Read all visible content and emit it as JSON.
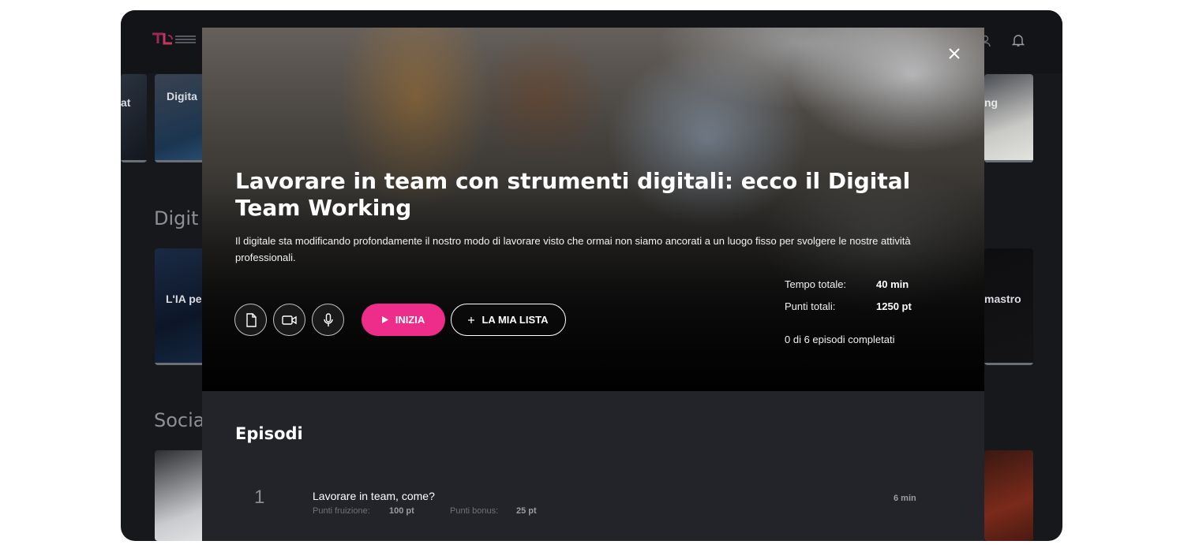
{
  "background": {
    "logo_text": "TENTACLE LEARNING PLATFORM",
    "row1": {
      "left_fragment": "at",
      "card_title": "Digita",
      "right_fragment": "ng"
    },
    "section2": {
      "title": "Digit",
      "card_left_title": "L'IA pe",
      "card_right_title": "mastro"
    },
    "section3": {
      "title": "Socia"
    }
  },
  "modal": {
    "close_icon": "close-icon",
    "title": "Lavorare in team con strumenti digitali: ecco il Digital Team Working",
    "description": "Il digitale sta modificando profondamente il nostro modo di lavorare visto che ormai non siamo ancorati a un luogo fisso per svolgere le nostre attività professionali.",
    "format_buttons": [
      {
        "icon": "document-icon"
      },
      {
        "icon": "video-icon"
      },
      {
        "icon": "microphone-icon"
      }
    ],
    "start_label": "INIZIA",
    "list_label": "LA MIA LISTA",
    "accent_color": "#ee2d8a",
    "stats": {
      "total_time_label": "Tempo totale:",
      "total_time_value": "40 min",
      "total_points_label": "Punti totali:",
      "total_points_value": "1250 pt",
      "progress_text": "0 di 6 episodi completati"
    },
    "episodes_title": "Episodi",
    "episodes": [
      {
        "number": "1",
        "title": "Lavorare in team, come?",
        "fruition_label": "Punti fruizione:",
        "fruition_value": "100 pt",
        "bonus_label": "Punti bonus:",
        "bonus_value": "25 pt",
        "duration": "6 min"
      }
    ]
  }
}
